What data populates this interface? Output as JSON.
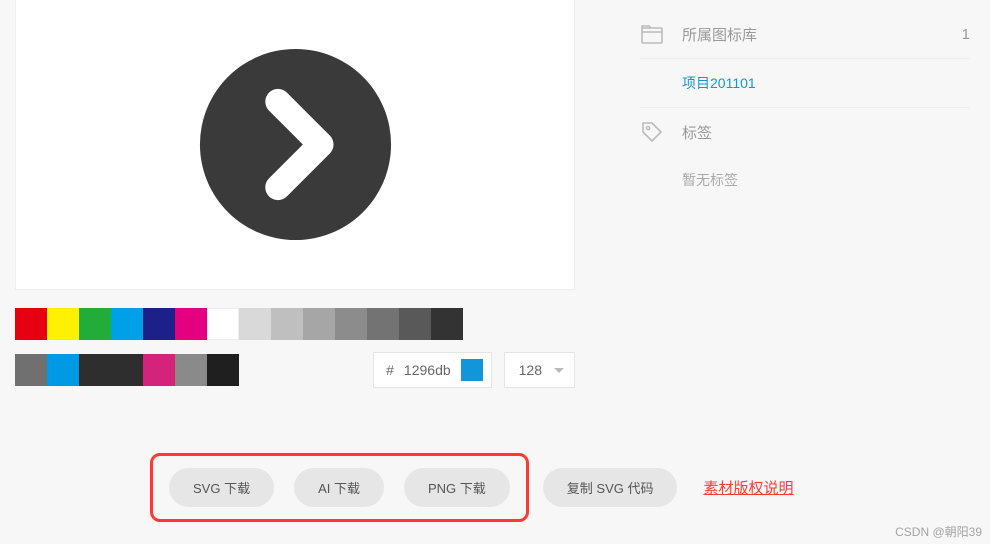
{
  "preview": {
    "icon_name": "chevron-right-circle",
    "icon_fill": "#3a3a3a"
  },
  "palette_row1": [
    "#e60012",
    "#fff100",
    "#22ac38",
    "#00a0e9",
    "#1d2088",
    "#e4007f",
    "#ffffff",
    "#d9d9d9",
    "#bfbfbf",
    "#a6a6a6",
    "#8c8c8c",
    "#737373",
    "#595959",
    "#333333"
  ],
  "palette_row2": [
    "#707070",
    "#0099e5",
    "#2e2e2e",
    "#2e2e2e",
    "#d4237a",
    "#8a8a8a",
    "#1f1f1f"
  ],
  "hex": {
    "prefix": "#",
    "value": "1296db",
    "preview_color": "#1296db"
  },
  "size": {
    "value": "128"
  },
  "meta": {
    "library_label": "所属图标库",
    "library_count": "1",
    "project_link": "项目201101",
    "tags_label": "标签",
    "tags_empty": "暂无标签"
  },
  "downloads": {
    "svg": "SVG 下载",
    "ai": "AI 下载",
    "png": "PNG 下载",
    "copy_svg": "复制 SVG 代码",
    "copyright": "素材版权说明"
  },
  "watermark": "CSDN @朝阳39"
}
